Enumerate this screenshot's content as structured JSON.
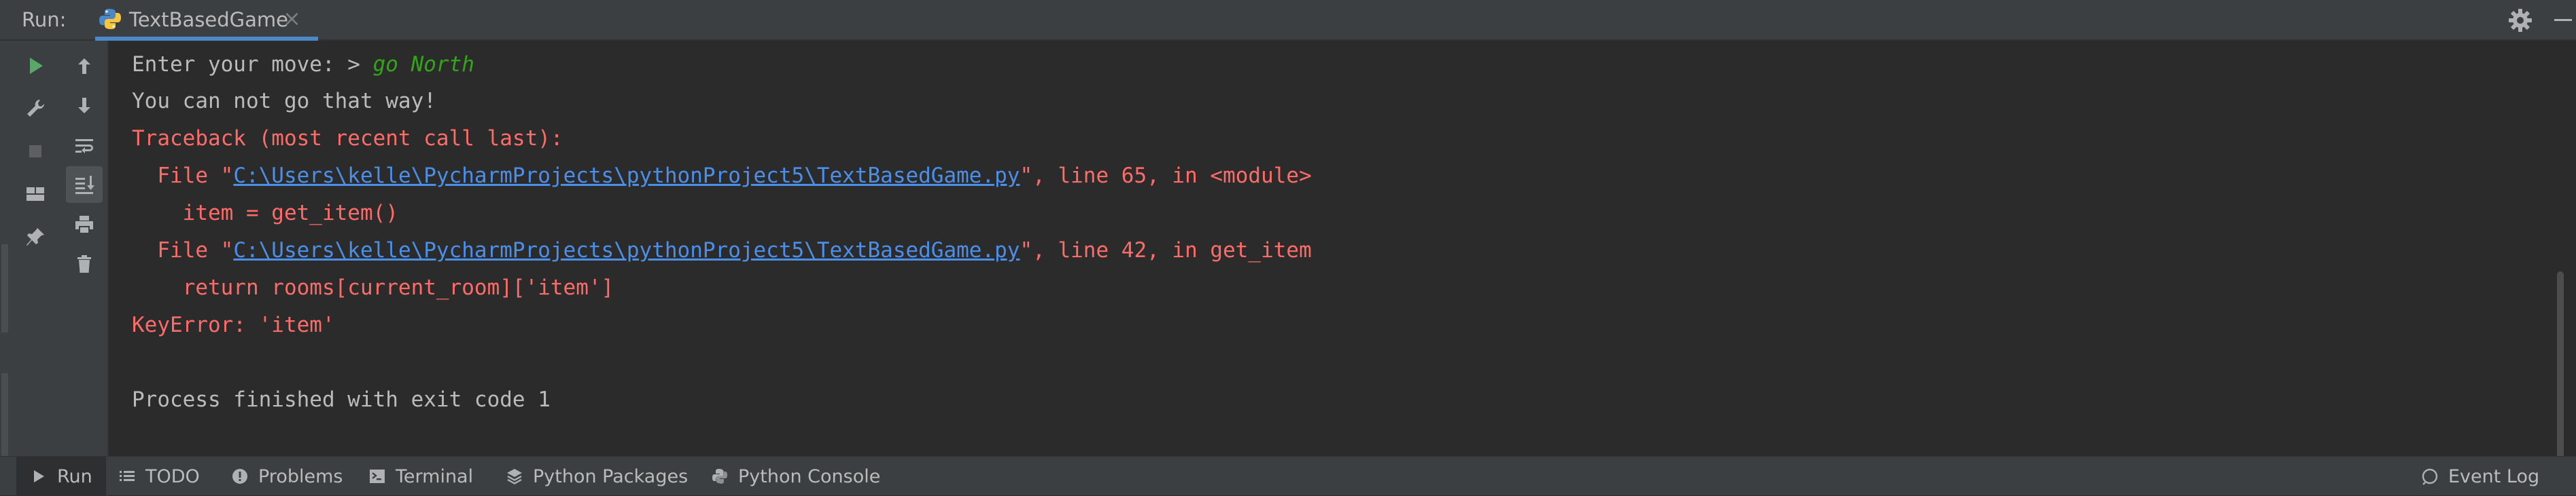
{
  "header": {
    "run_label": "Run:",
    "tab_label": "TextBasedGame",
    "tab_close": "×"
  },
  "console": {
    "lines": [
      {
        "prompt": "Enter your move: > ",
        "input": "go North"
      },
      {
        "text": "You can not go that way!"
      },
      {
        "text": "Traceback (most recent call last):"
      },
      {
        "prefix": "  File \"",
        "link": "C:\\Users\\kelle\\PycharmProjects\\pythonProject5\\TextBasedGame.py",
        "suffix": "\", line 65, in <module>"
      },
      {
        "text": "    item = get_item()"
      },
      {
        "prefix": "  File \"",
        "link": "C:\\Users\\kelle\\PycharmProjects\\pythonProject5\\TextBasedGame.py",
        "suffix": "\", line 42, in get_item"
      },
      {
        "text": "    return rooms[current_room]['item']"
      },
      {
        "text": "KeyError: 'item'"
      },
      {
        "text": ""
      },
      {
        "text": "Process finished with exit code 1"
      }
    ]
  },
  "bottom_bar": {
    "items": [
      {
        "label": "Run",
        "icon": "play-icon"
      },
      {
        "label": "TODO",
        "icon": "list-icon"
      },
      {
        "label": "Problems",
        "icon": "info-icon"
      },
      {
        "label": "Terminal",
        "icon": "terminal-icon"
      },
      {
        "label": "Python Packages",
        "icon": "layers-icon"
      },
      {
        "label": "Python Console",
        "icon": "python-icon"
      }
    ],
    "event_log": "Event Log"
  },
  "colors": {
    "accent": "#4a88c7",
    "error": "#ff6b68",
    "input": "#31a617",
    "link": "#4b8fe8",
    "run_green": "#59a869"
  }
}
